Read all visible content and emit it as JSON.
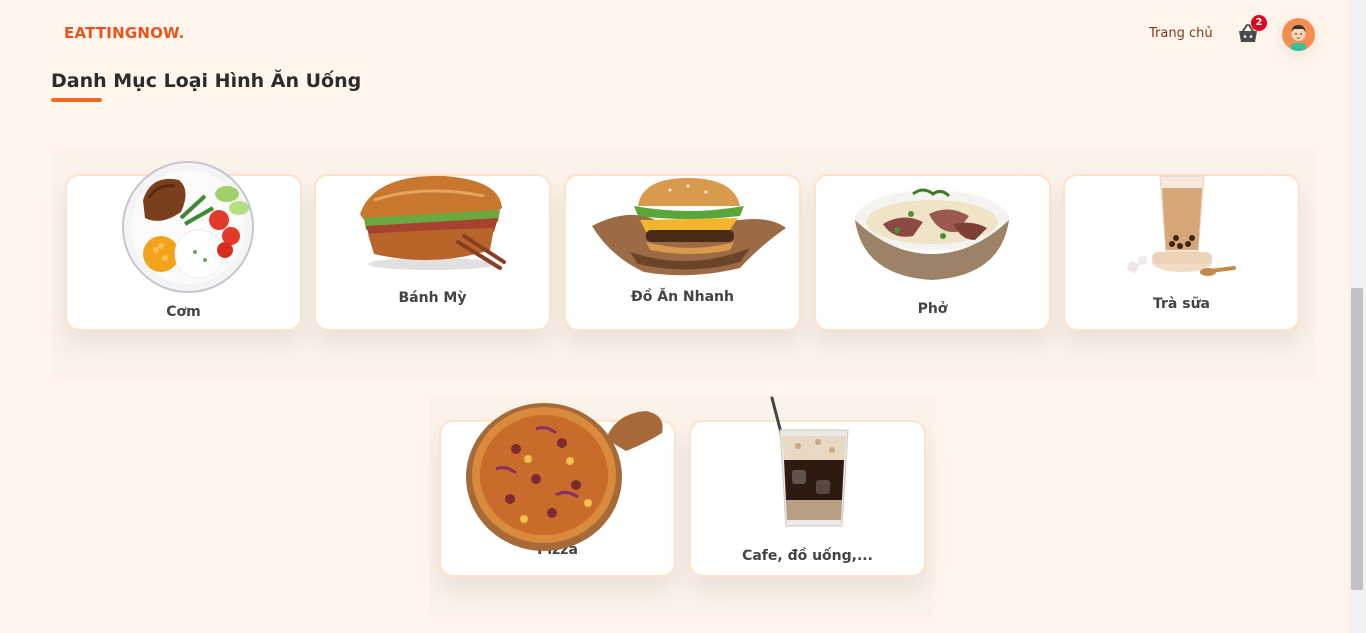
{
  "header": {
    "logo": "EATTINGNOW.",
    "nav_home": "Trang chủ",
    "cart_count": "2",
    "cart_icon": "shopping-basket-icon",
    "avatar_icon": "user-avatar-icon"
  },
  "section": {
    "title": "Danh Mục Loại Hình Ăn Uống"
  },
  "categories": [
    {
      "label": "Cơm",
      "image": "com-tam-plate-image"
    },
    {
      "label": "Bánh Mỳ",
      "image": "banh-mi-image"
    },
    {
      "label": "Đồ Ăn Nhanh",
      "image": "burger-image"
    },
    {
      "label": "Phở",
      "image": "pho-bowl-image"
    },
    {
      "label": "Trà sữa",
      "image": "milk-tea-image"
    },
    {
      "label": "Pizza",
      "image": "pizza-image"
    },
    {
      "label": "Cafe, đồ uống,...",
      "image": "iced-coffee-image"
    }
  ],
  "colors": {
    "brand": "#e8551a",
    "accent_underline": "#f26a21",
    "badge": "#e0001b",
    "background": "#fff5ec",
    "card_border": "#fde3c9"
  }
}
